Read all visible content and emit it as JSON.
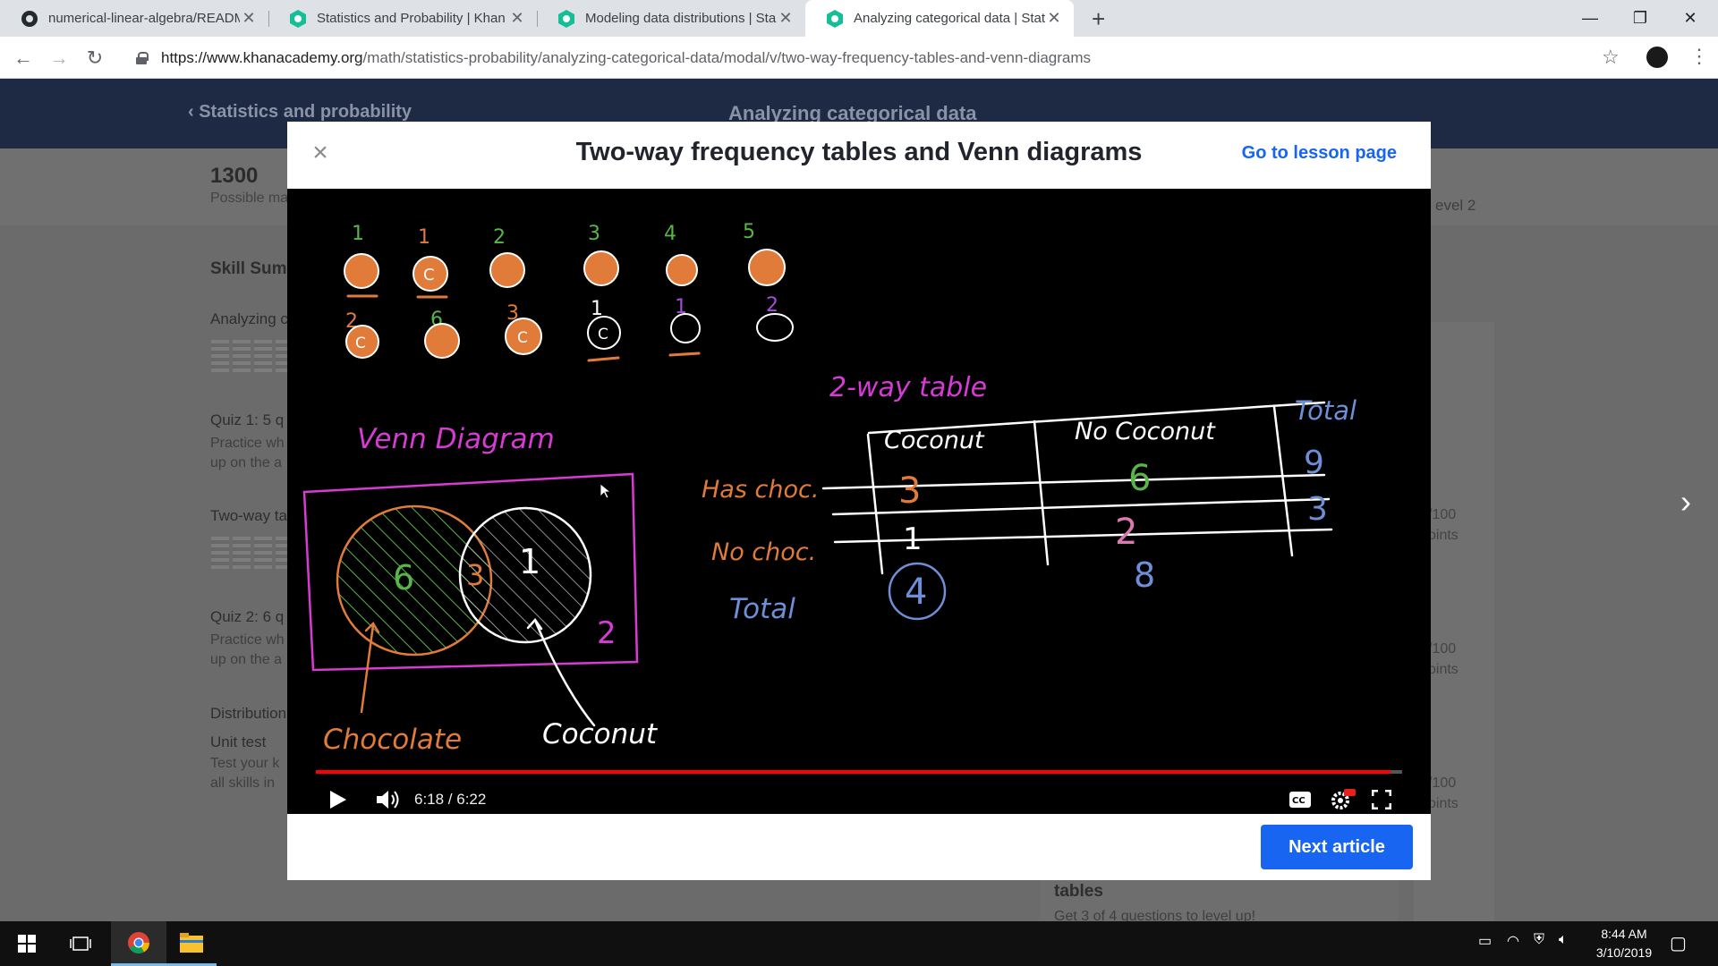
{
  "browser": {
    "tabs": [
      {
        "title": "numerical-linear-algebra/READM",
        "icon": "github-icon"
      },
      {
        "title": "Statistics and Probability | Khan A",
        "icon": "khan-academy-icon"
      },
      {
        "title": "Modeling data distributions | Sta",
        "icon": "khan-academy-icon"
      },
      {
        "title": "Analyzing categorical data | Stati",
        "icon": "khan-academy-icon",
        "active": true
      }
    ],
    "url_host": "https://www.khanacademy.org",
    "url_path": "/math/statistics-probability/analyzing-categorical-data/modal/v/two-way-frequency-tables-and-venn-diagrams"
  },
  "background_page": {
    "back_link": "Statistics and probability",
    "unit_title": "Analyzing categorical data",
    "points": "1300",
    "points_sub": "Possible ma",
    "skill_summary": "Skill Summ",
    "items": [
      {
        "label": "Analyzing c"
      },
      {
        "label": "Quiz 1: 5 q",
        "sub1": "Practice wh",
        "sub2": "up on the a"
      },
      {
        "label": "Two-way ta"
      },
      {
        "label": "Quiz 2: 6 q",
        "sub1": "Practice wh",
        "sub2": "up on the a"
      },
      {
        "label": "Distribution"
      },
      {
        "label": "Unit test",
        "sub1": "Test your k",
        "sub2": "all skills in"
      }
    ],
    "level_text": "evel 2",
    "right_points": [
      "/100",
      "oints",
      "/100",
      "oints",
      "/100",
      "oints"
    ],
    "bottom_card_title": "tables",
    "bottom_card_sub": "Get 3 of 4 questions to level up!"
  },
  "modal": {
    "title": "Two-way frequency tables and Venn diagrams",
    "lesson_link": "Go to lesson page",
    "next_button": "Next article",
    "player": {
      "time": "6:18 / 6:22",
      "progress": 0.989
    },
    "board": {
      "top_numbers": [
        "1",
        "1",
        "2",
        "3",
        "4",
        "5"
      ],
      "bottom_numbers": [
        "2",
        "6",
        "3",
        "1",
        "1",
        "2"
      ],
      "table_title": "2-way table",
      "columns": [
        "Coconut",
        "No Coconut",
        "Total"
      ],
      "rows": [
        {
          "label": "Has choc.",
          "values": [
            "3",
            "6",
            "9"
          ]
        },
        {
          "label": "No choc.",
          "values": [
            "1",
            "2",
            "3"
          ]
        },
        {
          "label": "Total",
          "values": [
            "4",
            "8",
            ""
          ]
        }
      ],
      "venn_title": "Venn Diagram",
      "venn_left": "6",
      "venn_middle": "3",
      "venn_right": "1",
      "venn_outside": "2",
      "label_chocolate": "Chocolate",
      "label_coconut": "Coconut"
    }
  },
  "taskbar": {
    "time": "8:44 AM",
    "date": "3/10/2019"
  },
  "colors": {
    "ka_blue": "#1865f2",
    "progress_red": "#ff0000",
    "pink": "#d63bd3",
    "orange": "#e07b39",
    "green": "#59b548",
    "blue_chalk": "#6e8fd8"
  }
}
